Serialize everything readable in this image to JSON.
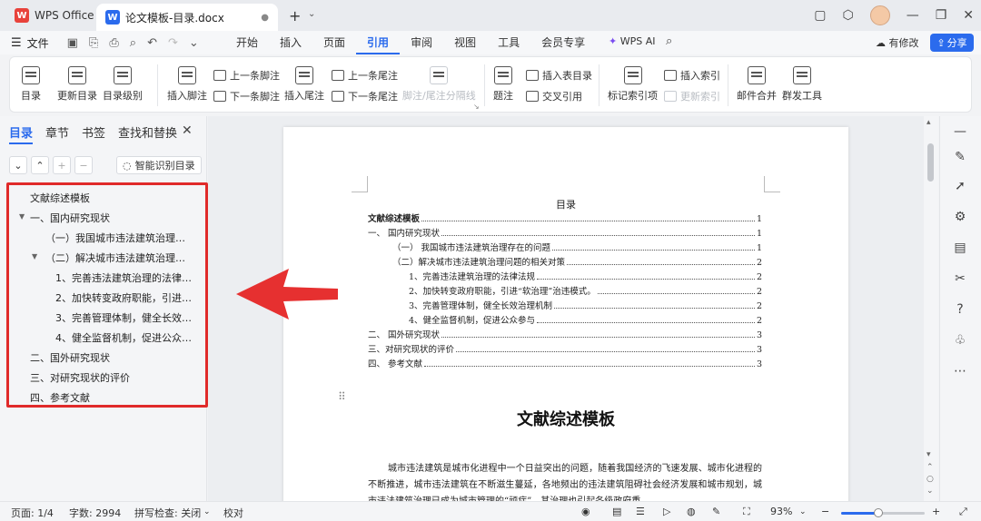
{
  "titlebar": {
    "home_tab": "WPS Office",
    "doc_tab": "论文模板-目录.docx"
  },
  "menubar": {
    "file_label": "文件",
    "items": [
      "开始",
      "插入",
      "页面",
      "引用",
      "审阅",
      "视图",
      "工具",
      "会员专享"
    ],
    "active": "引用",
    "wps_ai": "WPS AI",
    "changes": "有修改",
    "share": "分享"
  },
  "ribbon": {
    "toc": "目录",
    "update_toc": "更新目录",
    "toc_level": "目录级别",
    "insert_footnote": "插入脚注",
    "prev_footnote": "上一条脚注",
    "next_footnote": "下一条脚注",
    "insert_endnote": "插入尾注",
    "prev_endnote": "上一条尾注",
    "next_endnote": "下一条尾注",
    "separator": "脚注/尾注分隔线",
    "caption": "题注",
    "insert_table_of_figures": "插入表目录",
    "cross_reference": "交叉引用",
    "mark_index": "标记索引项",
    "insert_index": "插入索引",
    "update_index": "更新索引",
    "mail_merge": "邮件合并",
    "mass_send": "群发工具"
  },
  "left_panel": {
    "tabs": [
      "目录",
      "章节",
      "书签",
      "查找和替换"
    ],
    "active_tab": "目录",
    "smart_toc": "智能识别目录",
    "items": [
      {
        "text": "文献综述模板",
        "level": 0
      },
      {
        "text": "一、国内研究现状",
        "level": 0,
        "expanded": true
      },
      {
        "text": "（一）我国城市违法建筑治理存在...",
        "level": 1
      },
      {
        "text": "（二）解决城市违法建筑治理问...",
        "level": 1,
        "expanded": true
      },
      {
        "text": "1、完善违法建筑治理的法律法...",
        "level": 2
      },
      {
        "text": "2、加快转变政府职能，引进 \"...",
        "level": 2
      },
      {
        "text": "3、完善管理体制，健全长效治...",
        "level": 2
      },
      {
        "text": "4、健全监督机制，促进公众参...",
        "level": 2
      },
      {
        "text": "二、国外研究现状",
        "level": 0
      },
      {
        "text": "三、对研究现状的评价",
        "level": 0
      },
      {
        "text": "四、参考文献",
        "level": 0
      }
    ]
  },
  "document": {
    "toc_heading": "目录",
    "toc_entries": [
      {
        "text": "文献综述模板",
        "page": "1",
        "indent": 0,
        "bold": true
      },
      {
        "text": "一、  国内研究现状",
        "page": "1",
        "indent": 0
      },
      {
        "text": "（一）   我国城市违法建筑治理存在的问题",
        "page": "1",
        "indent": 1
      },
      {
        "text": "（二）解决城市违法建筑治理问题的相关对策",
        "page": "2",
        "indent": 1
      },
      {
        "text": "1、完善违法建筑治理的法律法规",
        "page": "2",
        "indent": 2
      },
      {
        "text": "2、加快转变政府职能，引进“软治理”治违模式。",
        "page": "2",
        "indent": 2
      },
      {
        "text": "3、完善管理体制，健全长效治理机制",
        "page": "2",
        "indent": 2
      },
      {
        "text": "4、健全监督机制，促进公众参与",
        "page": "2",
        "indent": 2
      },
      {
        "text": "二、  国外研究现状",
        "page": "3",
        "indent": 0
      },
      {
        "text": "三、对研究现状的评价",
        "page": "3",
        "indent": 0
      },
      {
        "text": "四、  参考文献",
        "page": "3",
        "indent": 0
      }
    ],
    "title": "文献综述模板",
    "body": "城市违法建筑是城市化进程中一个日益突出的问题，随着我国经济的飞速发展、城市化进程的不断推进，城市违法建筑在不断滋生蔓延，各地频出的违法建筑阻碍社会经济发展和城市规划，城市违法建筑治理已成为城市管理的“顽症”，其治理也引起各级政府重"
  },
  "statusbar": {
    "page": "页面: 1/4",
    "words": "字数: 2994",
    "spell": "拼写检查: 关闭",
    "proof": "校对",
    "zoom": "93%",
    "zoom_fraction": 0.45
  },
  "colors": {
    "accent": "#2b6bed",
    "highlight_red": "#e02a2a"
  }
}
